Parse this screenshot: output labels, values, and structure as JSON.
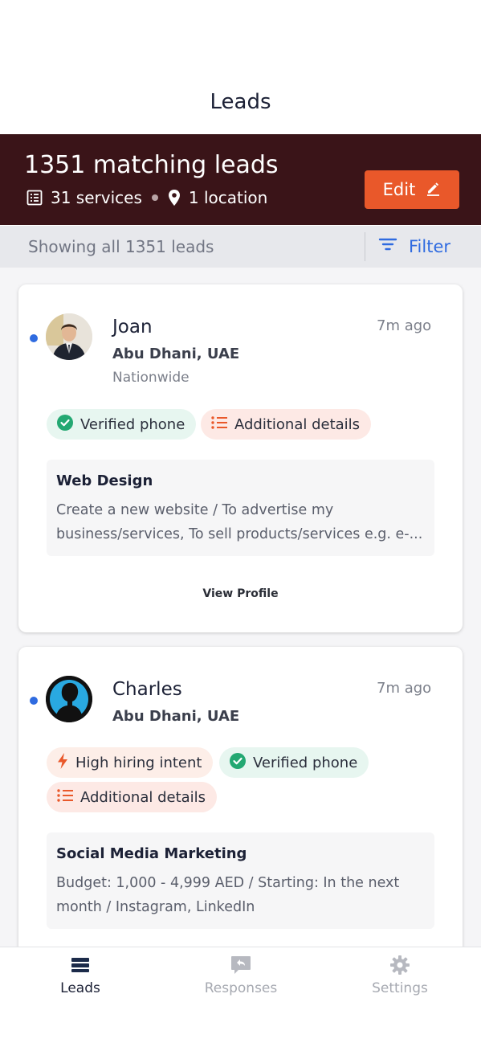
{
  "header": {
    "title": "Leads"
  },
  "banner": {
    "count_label": "1351 matching leads",
    "services_label": "31 services",
    "location_label": "1 location",
    "edit_label": "Edit"
  },
  "filter_bar": {
    "info": "Showing all 1351 leads",
    "filter_label": "Filter"
  },
  "leads": [
    {
      "name": "Joan",
      "location": "Abu Dhani, UAE",
      "scope": "Nationwide",
      "time": "7m ago",
      "badges": [
        "Verified phone",
        "Additional details"
      ],
      "service": "Web Design",
      "description": "Create a new website / To advertise my business/services, To sell products/services e.g. e-...",
      "view_profile": "View Profile"
    },
    {
      "name": "Charles",
      "location": "Abu Dhani, UAE",
      "time": "7m ago",
      "badges": [
        "High hiring intent",
        "Verified phone",
        "Additional details"
      ],
      "service": "Social Media Marketing",
      "description": "Budget: 1,000 - 4,999 AED / Starting: In the next month / Instagram, LinkedIn"
    }
  ],
  "tabs": [
    {
      "label": "Leads",
      "active": true
    },
    {
      "label": "Responses",
      "active": false
    },
    {
      "label": "Settings",
      "active": false
    }
  ],
  "colors": {
    "banner": "#3a1418",
    "accent": "#e9582a",
    "link": "#2f6be0"
  },
  "icons": [
    "services-list-icon",
    "location-pin-icon",
    "pencil-icon",
    "filter-icon",
    "check-circle-icon",
    "list-icon",
    "bolt-icon",
    "leads-tab-icon",
    "responses-tab-icon",
    "settings-gear-icon"
  ]
}
